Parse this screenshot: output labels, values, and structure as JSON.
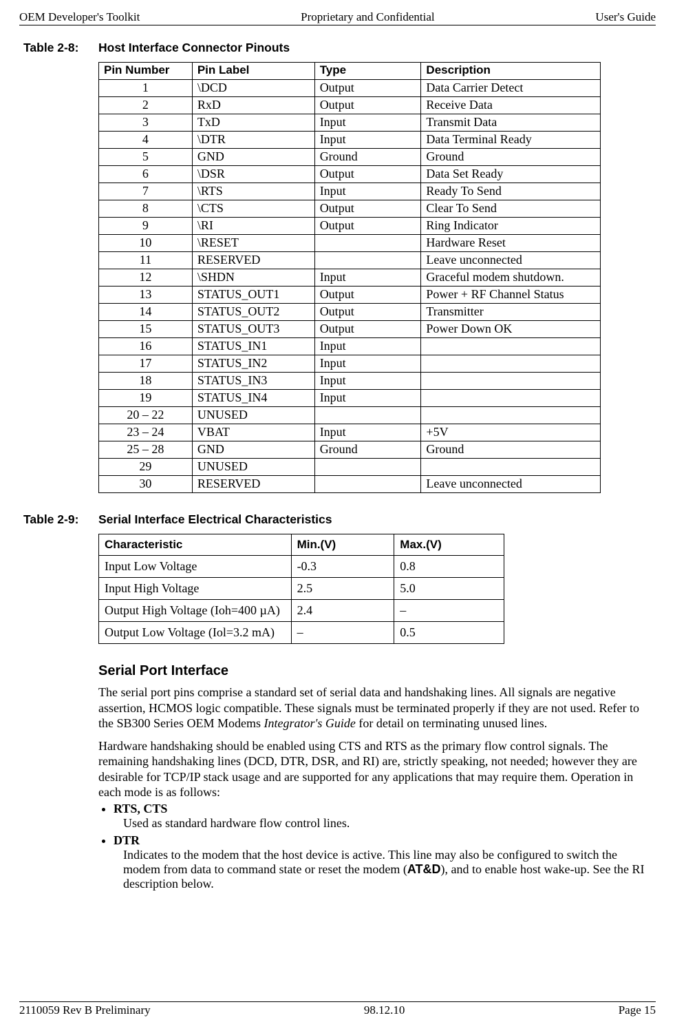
{
  "header": {
    "left": "OEM Developer's Toolkit",
    "center": "Proprietary and Confidential",
    "right": "User's Guide"
  },
  "table28": {
    "label": "Table 2-8:",
    "title": "Host Interface Connector Pinouts",
    "headers": [
      "Pin Number",
      "Pin Label",
      "Type",
      "Description"
    ],
    "rows": [
      {
        "pin": "1",
        "label": "\\DCD",
        "type": "Output",
        "desc": "Data Carrier Detect"
      },
      {
        "pin": "2",
        "label": "RxD",
        "type": "Output",
        "desc": "Receive Data"
      },
      {
        "pin": "3",
        "label": "TxD",
        "type": "Input",
        "desc": "Transmit Data"
      },
      {
        "pin": "4",
        "label": "\\DTR",
        "type": "Input",
        "desc": "Data Terminal Ready"
      },
      {
        "pin": "5",
        "label": "GND",
        "type": "Ground",
        "desc": "Ground"
      },
      {
        "pin": "6",
        "label": "\\DSR",
        "type": "Output",
        "desc": "Data Set Ready"
      },
      {
        "pin": "7",
        "label": "\\RTS",
        "type": "Input",
        "desc": "Ready To Send"
      },
      {
        "pin": "8",
        "label": "\\CTS",
        "type": "Output",
        "desc": "Clear To Send"
      },
      {
        "pin": "9",
        "label": "\\RI",
        "type": "Output",
        "desc": "Ring Indicator"
      },
      {
        "pin": "10",
        "label": "\\RESET",
        "type": "",
        "desc": "Hardware Reset"
      },
      {
        "pin": "11",
        "label": "RESERVED",
        "type": "",
        "desc": "Leave unconnected"
      },
      {
        "pin": "12",
        "label": "\\SHDN",
        "type": "Input",
        "desc": "Graceful modem shutdown."
      },
      {
        "pin": "13",
        "label": "STATUS_OUT1",
        "type": "Output",
        "desc": "Power + RF Channel Status"
      },
      {
        "pin": "14",
        "label": "STATUS_OUT2",
        "type": "Output",
        "desc": "Transmitter"
      },
      {
        "pin": "15",
        "label": "STATUS_OUT3",
        "type": "Output",
        "desc": "Power Down OK"
      },
      {
        "pin": "16",
        "label": "STATUS_IN1",
        "type": "Input",
        "desc": ""
      },
      {
        "pin": "17",
        "label": "STATUS_IN2",
        "type": "Input",
        "desc": ""
      },
      {
        "pin": "18",
        "label": "STATUS_IN3",
        "type": "Input",
        "desc": ""
      },
      {
        "pin": "19",
        "label": "STATUS_IN4",
        "type": "Input",
        "desc": ""
      },
      {
        "pin": "20 – 22",
        "label": "UNUSED",
        "type": "",
        "desc": ""
      },
      {
        "pin": "23 – 24",
        "label": "VBAT",
        "type": "Input",
        "desc": "+5V"
      },
      {
        "pin": "25 – 28",
        "label": "GND",
        "type": "Ground",
        "desc": "Ground"
      },
      {
        "pin": "29",
        "label": "UNUSED",
        "type": "",
        "desc": ""
      },
      {
        "pin": "30",
        "label": "RESERVED",
        "type": "",
        "desc": "Leave unconnected"
      }
    ]
  },
  "table29": {
    "label": "Table 2-9:",
    "title": "Serial Interface Electrical Characteristics",
    "headers": [
      "Characteristic",
      "Min.(V)",
      "Max.(V)"
    ],
    "rows": [
      {
        "char": "Input Low Voltage",
        "min": "-0.3",
        "max": "0.8"
      },
      {
        "char": "Input High Voltage",
        "min": "2.5",
        "max": "5.0"
      },
      {
        "char": "Output High Voltage (Ioh=400 µA)",
        "min": "2.4",
        "max": "–"
      },
      {
        "char": "Output Low Voltage (Iol=3.2 mA)",
        "min": "–",
        "max": "0.5"
      }
    ]
  },
  "section": {
    "heading": "Serial Port Interface",
    "p1a": "The serial port pins comprise a standard set of serial data and handshaking lines.  All signals are negative assertion, HCMOS logic compatible.  These signals must be terminated properly if they are not used.  Refer to the SB300 Series OEM Modems ",
    "p1_italic": "Integrator's Guide",
    "p1b": " for detail on terminating unused lines.",
    "p2": "Hardware handshaking should be enabled using CTS and RTS as the primary flow control signals.  The remaining handshaking lines (DCD, DTR, DSR, and RI) are, strictly speaking, not needed; however they are desirable for TCP/IP stack usage and are supported for any applications that may require them.  Operation in each mode is as follows:",
    "bullets": [
      {
        "head": "RTS, CTS",
        "body": "Used as standard hardware flow control lines."
      },
      {
        "head": "DTR",
        "body_a": "Indicates to the modem that the host device is active.  This line may also be configured to switch the modem from data to command state or reset the modem (",
        "body_bold": "AT&D",
        "body_b": "), and to enable host wake-up.  See the RI description below."
      }
    ]
  },
  "footer": {
    "left": "2110059 Rev B Preliminary",
    "center": "98.12.10",
    "right": "Page 15"
  }
}
